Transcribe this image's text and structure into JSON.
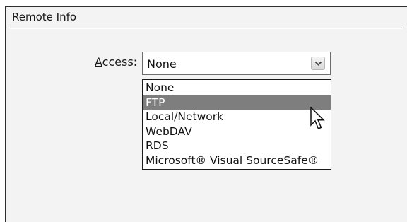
{
  "section": {
    "title": "Remote Info"
  },
  "access": {
    "label_mnemonic": "A",
    "label_rest": "ccess:",
    "selected_value": "None",
    "arrow_icon": "chevron-down-icon",
    "options": [
      "None",
      "FTP",
      "Local/Network",
      "WebDAV",
      "RDS",
      "Microsoft® Visual SourceSafe®"
    ],
    "highlighted_option": "FTP"
  },
  "cursor": {
    "icon": "arrow-pointer-icon"
  },
  "colors": {
    "highlight": "#7e7e7e",
    "panel_background": "#f3f3f3"
  }
}
